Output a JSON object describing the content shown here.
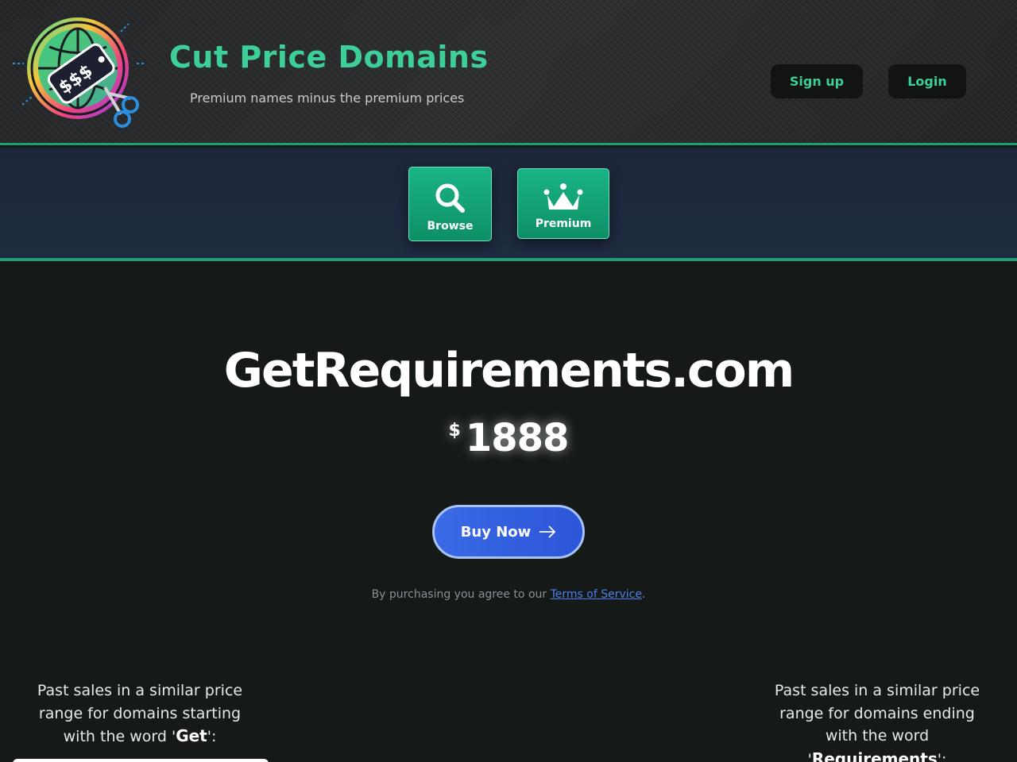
{
  "header": {
    "site_title": "Cut Price Domains",
    "tagline": "Premium names minus the premium prices",
    "signup_label": "Sign up",
    "login_label": "Login",
    "accent_color": "#3ccf97"
  },
  "nav": {
    "items": [
      {
        "label": "Browse",
        "icon": "magnifier-icon"
      },
      {
        "label": "Premium",
        "icon": "crown-icon"
      }
    ]
  },
  "main": {
    "domain_name": "GetRequirements.com",
    "currency_symbol": "$",
    "price": "1888",
    "buy_label": "Buy Now",
    "terms_prefix": "By purchasing you agree to our ",
    "terms_link": "Terms of Service",
    "terms_suffix": "."
  },
  "past_sales": {
    "left_text": "Past sales in a similar price range for domains starting with the word '",
    "left_word": "Get",
    "left_end": "':",
    "right_text": "Past sales in a similar price range for domains ending with the word '",
    "right_word": "Requirements",
    "right_end": "':"
  }
}
